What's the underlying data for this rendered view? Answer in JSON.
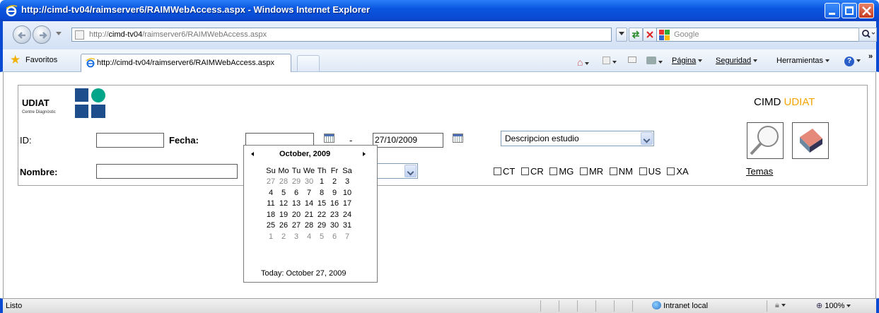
{
  "window": {
    "title": "http://cimd-tv04/raimserver6/RAIMWebAccess.aspx - Windows Internet Explorer"
  },
  "address": {
    "url_prefix": "http://",
    "url_host": "cimd-tv04",
    "url_path": "/raimserver6/RAIMWebAccess.aspx",
    "search_placeholder": "Google"
  },
  "favorites": {
    "label": "Favoritos",
    "tab_label": "http://cimd-tv04/raimserver6/RAIMWebAccess.aspx"
  },
  "commandbar": {
    "pagina": "Página",
    "seguridad": "Seguridad",
    "herramientas": "Herramientas"
  },
  "page": {
    "logo_name": "UDIAT",
    "logo_sub": "Centre Diagnòstic",
    "brand_left": "CIMD",
    "brand_right": "UDIAT",
    "id_label": "ID:",
    "id_value": "",
    "fecha_label": "Fecha:",
    "fecha_from": "",
    "dash": "-",
    "fecha_to": "27/10/2009",
    "nombre_label": "Nombre:",
    "nombre_value": "",
    "descripcion_select": "Descripcion estudio",
    "second_select": "",
    "modalities": [
      "CT",
      "CR",
      "MG",
      "MR",
      "NM",
      "US",
      "XA"
    ],
    "temas_link": "Temas"
  },
  "calendar": {
    "month_title": "October, 2009",
    "weekdays": [
      "Su",
      "Mo",
      "Tu",
      "We",
      "Th",
      "Fr",
      "Sa"
    ],
    "weeks": [
      [
        "27",
        "28",
        "29",
        "30",
        "1",
        "2",
        "3"
      ],
      [
        "4",
        "5",
        "6",
        "7",
        "8",
        "9",
        "10"
      ],
      [
        "11",
        "12",
        "13",
        "14",
        "15",
        "16",
        "17"
      ],
      [
        "18",
        "19",
        "20",
        "21",
        "22",
        "23",
        "24"
      ],
      [
        "25",
        "26",
        "27",
        "28",
        "29",
        "30",
        "31"
      ],
      [
        "1",
        "2",
        "3",
        "4",
        "5",
        "6",
        "7"
      ]
    ],
    "today_label": "Today: October 27, 2009"
  },
  "status": {
    "text": "Listo",
    "zone": "Intranet local",
    "zoom": "100%"
  },
  "colors": {
    "titlebar": "#0a4ad2",
    "brand_accent": "#f5a400",
    "logo_blue": "#1f4e8c",
    "logo_teal": "#00a58a"
  }
}
